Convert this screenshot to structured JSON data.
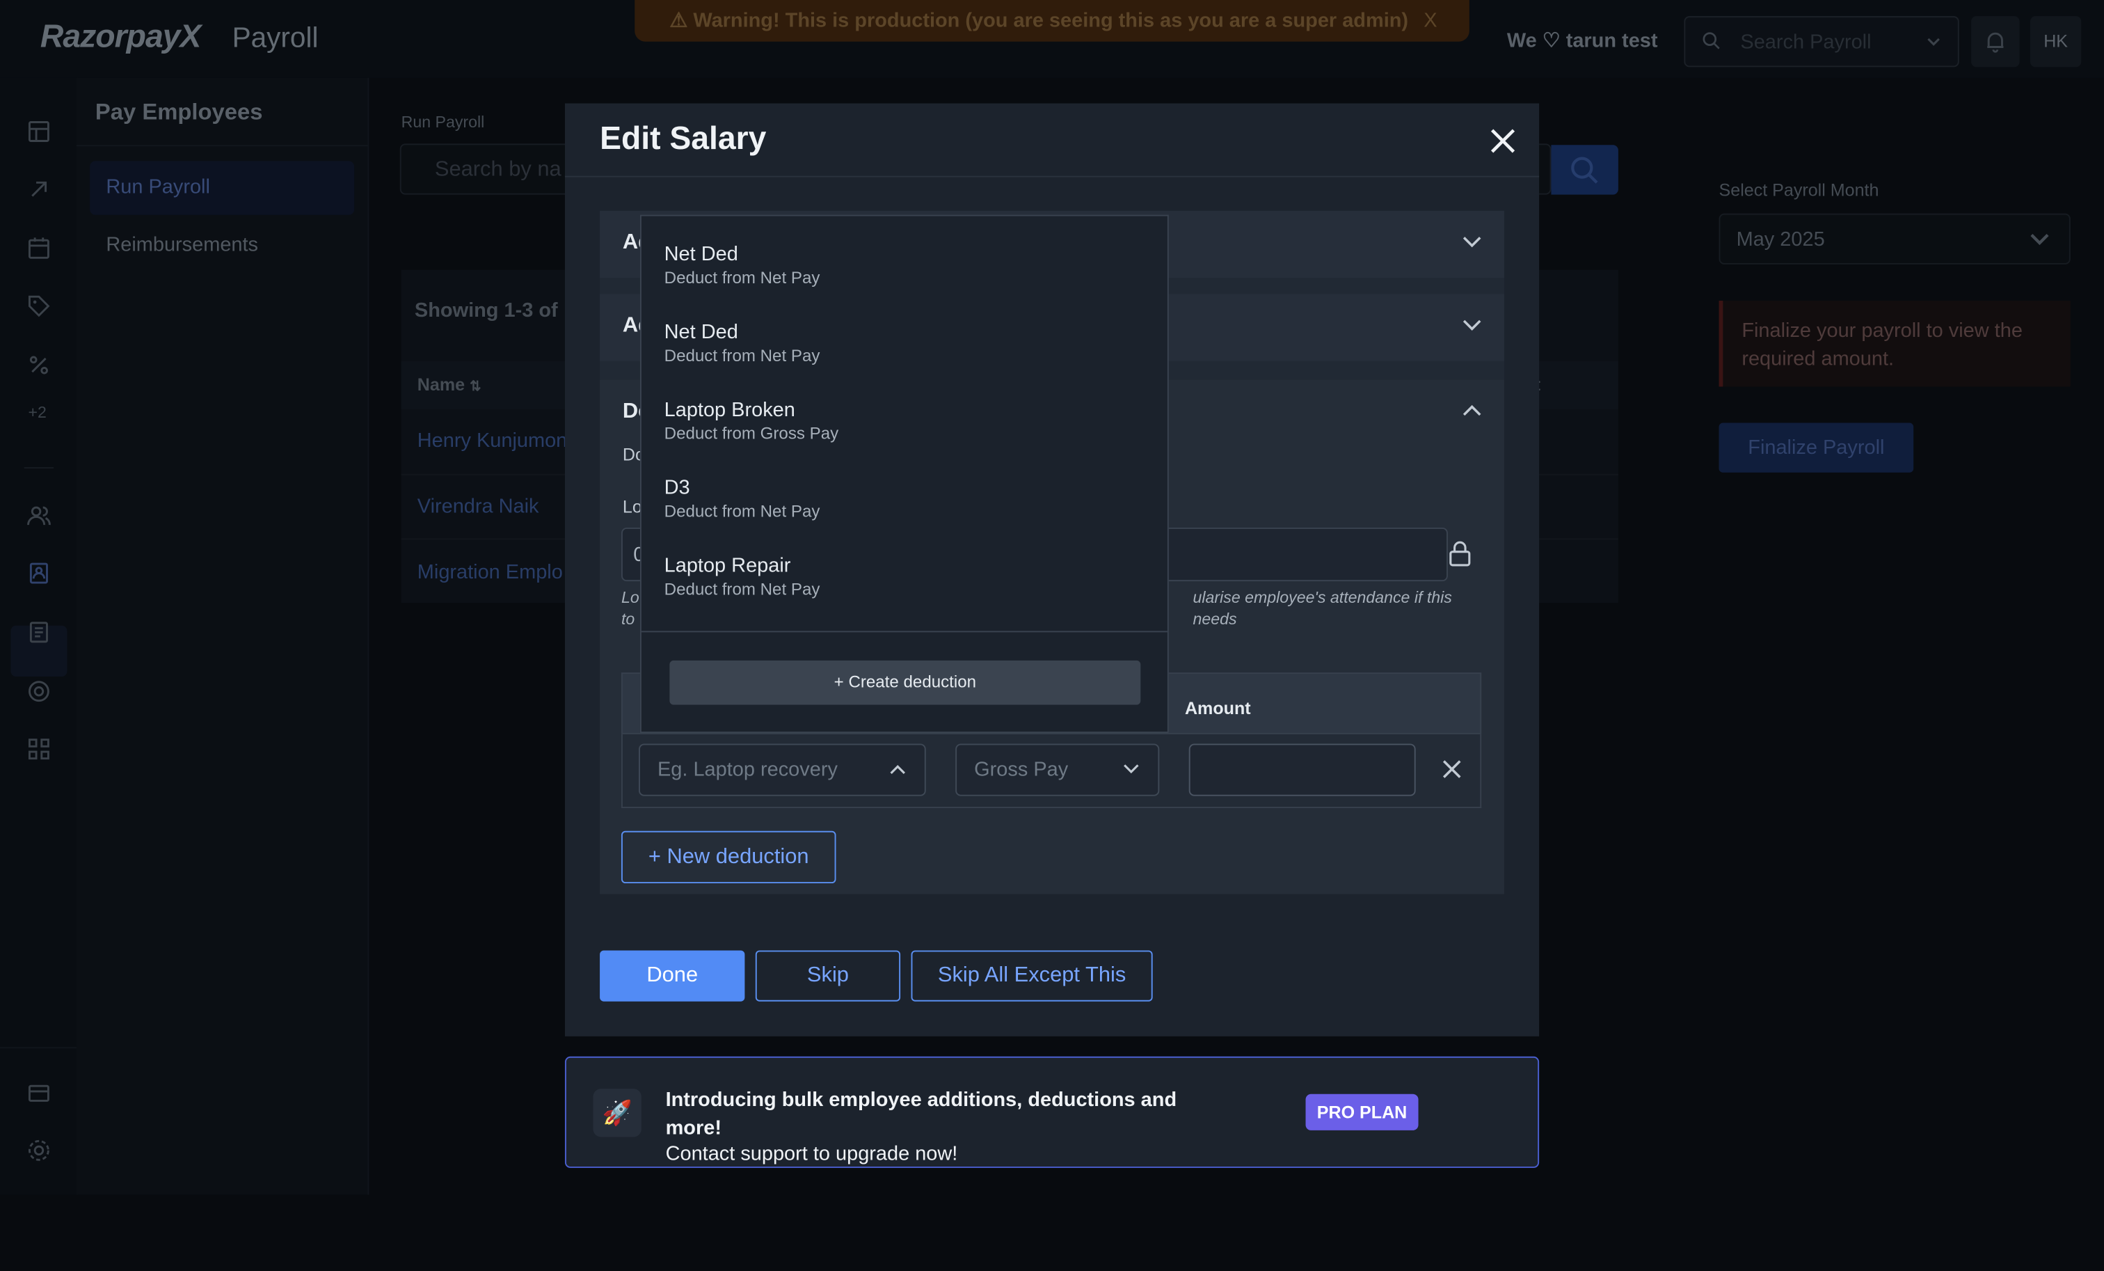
{
  "app": {
    "brand": "RazorpayX",
    "product": "Payroll",
    "warning": "⚠ Warning! This is production (you are seeing this as you are a super admin)",
    "warning_close": "X",
    "greeting": "We ♡ tarun test",
    "search_placeholder": "Search Payroll",
    "avatar_initials": "HK"
  },
  "rail": {
    "more_label": "+2"
  },
  "subnav": {
    "title": "Pay Employees",
    "items": [
      {
        "label": "Run Payroll"
      },
      {
        "label": "Reimbursements"
      }
    ]
  },
  "main": {
    "label": "Run Payroll",
    "search_placeholder": "Search by na",
    "showing": "Showing 1-3 of",
    "col_name": "Name",
    "col_right": "it",
    "rows": [
      "Henry Kunjumon",
      "Virendra Naik",
      "Migration Emplo"
    ]
  },
  "right": {
    "month_label": "Select Payroll Month",
    "month_value": "May 2025",
    "alert": "Finalize your payroll to view the required amount.",
    "finalize_label": "Finalize Payroll"
  },
  "modal": {
    "title": "Edit Salary",
    "acc1_label": "Ad",
    "acc2_label": "Ad",
    "deductions_label": "De",
    "ded_subtext": "Do",
    "lop_label": "Lo",
    "lop_value": "0",
    "helper_start": "Lo",
    "helper_end": "ularise employee's attendance if this needs",
    "helper_line2": "to",
    "amount_header": "Amount",
    "deduction_placeholder": "Eg. Laptop recovery",
    "pay_type": "Gross Pay",
    "new_deduction": "+ New deduction",
    "done": "Done",
    "skip": "Skip",
    "skip_all": "Skip All Except This"
  },
  "dropdown": {
    "items": [
      {
        "name": "Net Ded",
        "sub": "Deduct from Net Pay"
      },
      {
        "name": "Net Ded",
        "sub": "Deduct from Net Pay"
      },
      {
        "name": "Laptop Broken",
        "sub": "Deduct from Gross Pay"
      },
      {
        "name": "D3",
        "sub": "Deduct from Net Pay"
      },
      {
        "name": "Laptop Repair",
        "sub": "Deduct from Net Pay"
      }
    ],
    "create_label": "Create deduction"
  },
  "promo": {
    "line1": "Introducing bulk employee additions, deductions and more!",
    "line2": "Contact support to upgrade now!",
    "badge": "PRO PLAN"
  }
}
